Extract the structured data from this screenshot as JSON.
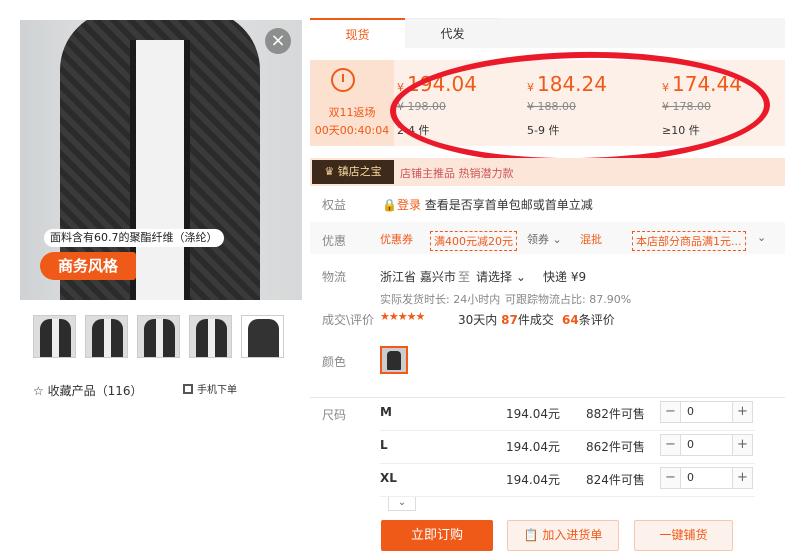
{
  "image": {
    "fabric_note": "面料含有60.7的聚酯纤维（涤纶）",
    "style_badge": "商务风格",
    "close_glyph": "×",
    "thumbnails": 5
  },
  "favorite": {
    "label": "☆  收藏产品（116）"
  },
  "mobile_order": {
    "label": "手机下单"
  },
  "tabs": [
    {
      "label": "现货"
    },
    {
      "label": "代发"
    }
  ],
  "promo_event": {
    "line1": "双11返场",
    "line2": "00天00:40:04"
  },
  "tiers": [
    {
      "price": "194.04",
      "original": "¥ 198.00",
      "qty": "2-4 件"
    },
    {
      "price": "184.24",
      "original": "¥ 188.00",
      "qty": "5-9 件"
    },
    {
      "price": "174.44",
      "original": "¥ 178.00",
      "qty": "≥10 件"
    }
  ],
  "currency": "¥",
  "shop": {
    "badge": "镇店之宝",
    "subtitle": "店铺主推品  热销潜力款"
  },
  "perks": {
    "label": "权益",
    "login": "登录",
    "text": "查看是否享首单包邮或首单立减"
  },
  "discount": {
    "label": "优惠",
    "coupon": "优惠券",
    "coupon_tag": "满400元减20元",
    "claim": "领券 ⌄",
    "mix": "混批",
    "mix_tag": "本店部分商品满1元...",
    "expand": "⌄"
  },
  "logistics": {
    "label": "物流",
    "from": "浙江省 嘉兴市",
    "to_word": "至",
    "select": "请选择 ⌄",
    "express": "快递 ¥9",
    "ship_time": "实际发货时长: 24小时内",
    "track_rate": "可跟踪物流占比: 87.90%"
  },
  "deals": {
    "label": "成交\\评价",
    "stars": "★★★★★",
    "period": "30天内",
    "deal_count": "87",
    "deal_suffix": "件成交",
    "review_count": "64",
    "review_suffix": "条评价"
  },
  "color": {
    "label": "颜色"
  },
  "size": {
    "label": "尺码",
    "rows": [
      {
        "name": "M",
        "price": "194.04元",
        "stock": "882件可售",
        "qty": "0"
      },
      {
        "name": "L",
        "price": "194.04元",
        "stock": "862件可售",
        "qty": "0"
      },
      {
        "name": "XL",
        "price": "194.04元",
        "stock": "824件可售",
        "qty": "0"
      }
    ],
    "more": "⌄"
  },
  "buttons": {
    "buy": "立即订购",
    "cart": "加入进货单",
    "distribute": "一键铺货"
  },
  "accent": "#f05a19",
  "annotation_color": "#ea1a2a"
}
